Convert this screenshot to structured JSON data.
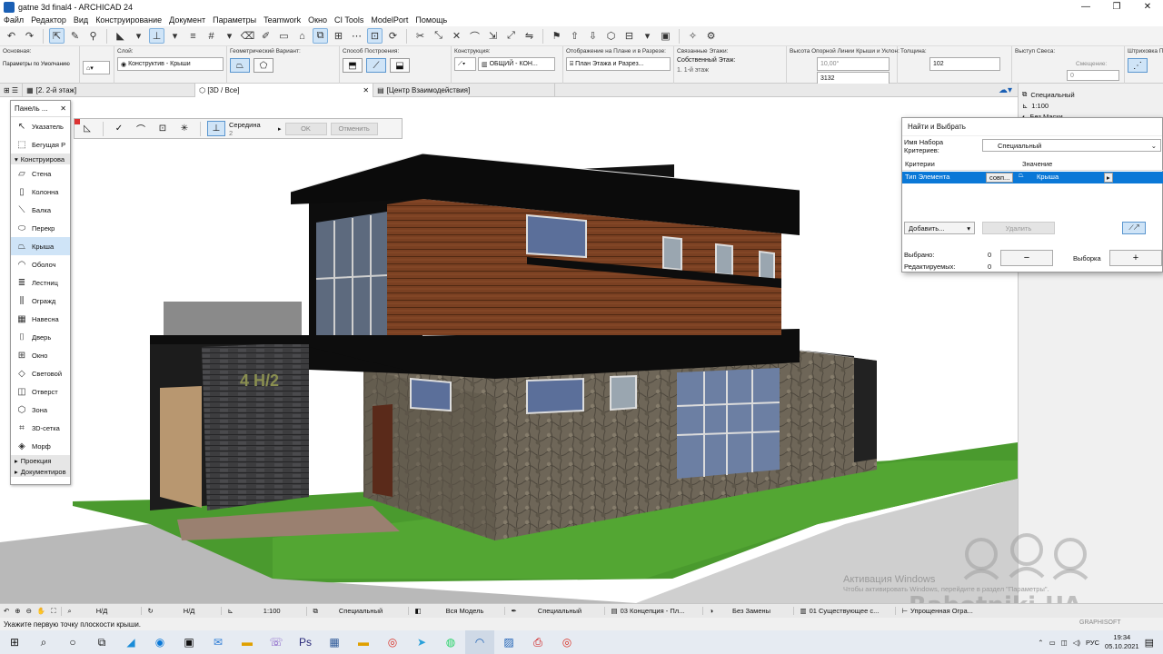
{
  "window": {
    "title": "gatne 3d final4 - ARCHICAD 24",
    "controls": [
      "—",
      "❐",
      "✕"
    ]
  },
  "menu": [
    "Файл",
    "Редактор",
    "Вид",
    "Конструирование",
    "Документ",
    "Параметры",
    "Teamwork",
    "Окно",
    "CI Tools",
    "ModelPort",
    "Помощь"
  ],
  "infobox": {
    "osnova_label": "Основная:",
    "osnova_value": "Параметры по Умолчанию",
    "layer_label": "Слой:",
    "layer_value": "Конструктив - Крыши",
    "geom_label": "Геометрический Вариант:",
    "build_label": "Способ Построения:",
    "constr_label": "Конструкция:",
    "constr_value": "ОБЩИЙ - КОН...",
    "display_label": "Отображение на Плане и в Разрезе:",
    "display_value": "План Этажа и Разрез...",
    "linked_label": "Связанные Этажи:",
    "linked_value": "Собственный Этаж:",
    "linked_sub": "1. 1-й этаж",
    "height_label": "Высота Опорной Линии Крыши и Уклон:",
    "angle_value": "10,00°",
    "height_value": "3132",
    "thickness_label": "Толщина:",
    "thickness_value": "102",
    "eave_label": "Выступ Свеса:",
    "offset_label": "Смещение:",
    "offset_value": "0",
    "hatch_label": "Штриховка Пол"
  },
  "tabs": [
    {
      "label": "[2. 2-й этаж]"
    },
    {
      "label": "[3D / Все]"
    },
    {
      "label": "[Центр Взаимодействия]"
    }
  ],
  "right_panel": {
    "items": [
      "Специальный",
      "1:100",
      "Без Маски"
    ]
  },
  "toolbox": {
    "title": "Панель ...",
    "items_top": [
      "Указатель",
      "Бегущая Р"
    ],
    "section_construct": "Конструирова",
    "tools": [
      "Стена",
      "Колонна",
      "Балка",
      "Перекр",
      "Крыша",
      "Оболоч",
      "Лестниц",
      "Огражд",
      "Навесна",
      "Дверь",
      "Окно",
      "Световой",
      "Отверст",
      "Зона",
      "3D-сетка",
      "Морф"
    ],
    "selected_tool": "Крыша",
    "section_projection": "Проекция",
    "section_document": "Документиров"
  },
  "pet_palette": {
    "label": "Середина",
    "sub": "2",
    "ok": "OK",
    "cancel": "Отменить"
  },
  "find_select": {
    "title": "Найти и Выбрать",
    "set_label": "Имя Набора Критериев:",
    "set_value": "Специальный",
    "col_criteria": "Критерии",
    "col_value": "Значение",
    "row_criterion": "Тип Элемента",
    "row_op": "совп...",
    "row_value": "Крыша",
    "add": "Добавить...",
    "delete": "Удалить",
    "selected_label": "Выбрано:",
    "selected_value": "0",
    "editable_label": "Редактируемых:",
    "editable_value": "0",
    "minus": "−",
    "selection": "Выборка",
    "plus": "+"
  },
  "building": {
    "sign": "4 Н/2"
  },
  "statusbar": {
    "zoom1": "Н/Д",
    "zoom2": "Н/Д",
    "scale": "1:100",
    "layers": "Специальный",
    "model": "Вся Модель",
    "pen": "Специальный",
    "renov": "03 Концепция - Пл...",
    "override": "Без Замены",
    "existing": "01 Существующее с...",
    "simplified": "Упрощенная Огра..."
  },
  "hint": "Укажите первую точку плоскости крыши.",
  "watermark": {
    "activate_title": "Активация Windows",
    "activate_text": "Чтобы активировать Windows, перейдите в раздел \"Параметры\".",
    "site": "Rabotniki.UA",
    "brand": "GRAPHISOFT"
  },
  "tray": {
    "lang": "РУС",
    "time": "19:34",
    "date": "05.10.2021"
  },
  "colors": {
    "accent": "#0a78d7",
    "grass": "#4a9a2e",
    "wood": "#7a4022",
    "stone": "#6e6658"
  }
}
